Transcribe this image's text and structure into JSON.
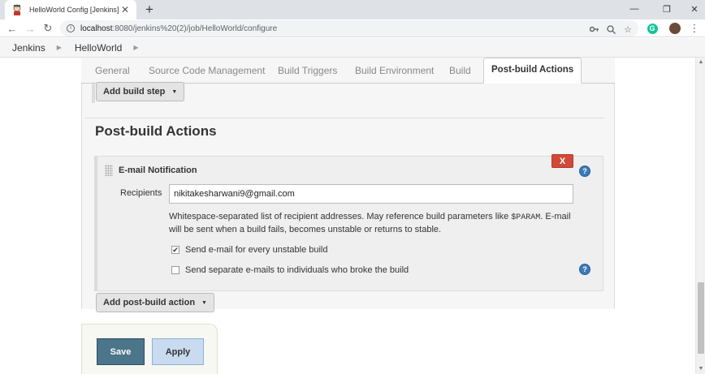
{
  "browser": {
    "tab_title": "HelloWorld Config [Jenkins]",
    "url_host": "localhost",
    "url_path": ":8080/jenkins%20(2)/job/HelloWorld/configure",
    "grammarly_letter": "G"
  },
  "breadcrumb": [
    "Jenkins",
    "HelloWorld"
  ],
  "config_tabs": [
    "General",
    "Source Code Management",
    "Build Triggers",
    "Build Environment",
    "Build",
    "Post-build Actions"
  ],
  "active_tab": "Post-build Actions",
  "add_build_step_label": "Add build step",
  "section_title": "Post-build Actions",
  "email_notification": {
    "title": "E-mail Notification",
    "delete_label": "X",
    "recipients_label": "Recipients",
    "recipients_value": "nikitakesharwani9@gmail.com",
    "help_text_1": "Whitespace-separated list of recipient addresses. May reference build parameters like ",
    "help_text_code": "$PARAM",
    "help_text_2": ". E-mail will be sent when a build fails, becomes unstable or returns to stable.",
    "option_unstable": "Send e-mail for every unstable build",
    "option_unstable_checked": "✔",
    "option_separate": "Send separate e-mails to individuals who broke the build",
    "help_glyph": "?"
  },
  "add_post_build_action_label": "Add post-build action",
  "save_label": "Save",
  "apply_label": "Apply"
}
